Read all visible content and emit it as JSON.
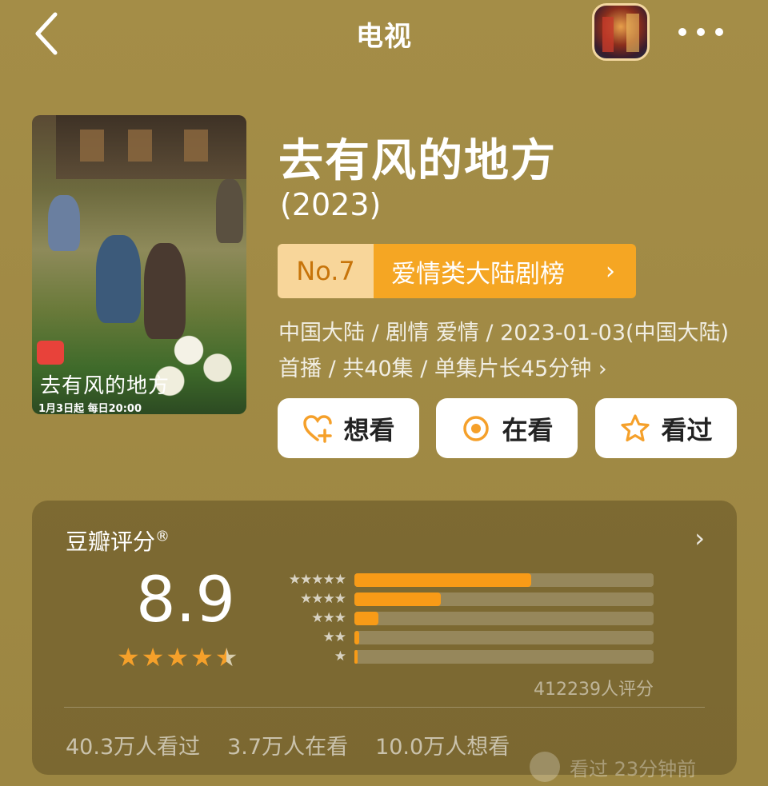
{
  "header": {
    "title": "电视",
    "back_icon": "chevron-left-icon",
    "more_icon": "more-dots-icon"
  },
  "poster": {
    "title_text": "去有风的地方",
    "air_info": "1月3日起  每日20:00"
  },
  "subject": {
    "title": "去有风的地方",
    "year": "(2023)",
    "rank_no": "No.7",
    "rank_name": "爱情类大陆剧榜",
    "rank_chevron": "›",
    "meta": "中国大陆 / 剧情 爱情 / 2023-01-03(中国大陆)首播 / 共40集 / 单集片长45分钟 ›"
  },
  "actions": {
    "want": "想看",
    "watching": "在看",
    "watched": "看过"
  },
  "rating": {
    "title": "豆瓣评分",
    "registered_mark": "®",
    "chevron": "›",
    "score": "8.9",
    "stars_value": 4.5,
    "distribution": [
      {
        "stars": "★★★★★",
        "fraction": 0.59
      },
      {
        "stars": "★★★★",
        "fraction": 0.29
      },
      {
        "stars": "★★★",
        "fraction": 0.08
      },
      {
        "stars": "★★",
        "fraction": 0.015
      },
      {
        "stars": "★",
        "fraction": 0.01
      }
    ],
    "count": "412239人评分",
    "watched_stat": "40.3万人看过",
    "watching_stat": "3.7万人在看",
    "want_stat": "10.0万人想看"
  },
  "watermark": {
    "text": "看过  23分钟前"
  },
  "colors": {
    "background": "#a08a45",
    "accent_orange": "#f5a623",
    "rank_no_bg": "#f8d69a",
    "bar_fill": "#f89b17"
  }
}
